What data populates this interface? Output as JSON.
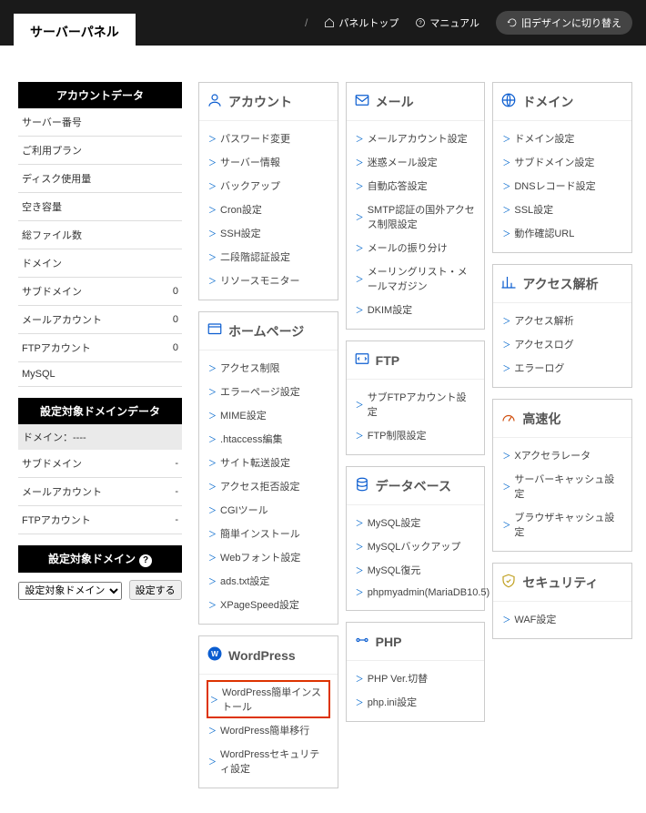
{
  "header": {
    "logo": "サーバーパネル",
    "panel_top": "パネルトップ",
    "manual": "マニュアル",
    "old_design": "旧デザインに切り替え"
  },
  "sidebar": {
    "account": {
      "title": "アカウントデータ",
      "rows": [
        {
          "label": "サーバー番号",
          "value": ""
        },
        {
          "label": "ご利用プラン",
          "value": ""
        },
        {
          "label": "ディスク使用量",
          "value": ""
        },
        {
          "label": "空き容量",
          "value": ""
        },
        {
          "label": "総ファイル数",
          "value": ""
        },
        {
          "label": "ドメイン",
          "value": ""
        },
        {
          "label": "サブドメイン",
          "value": "0"
        },
        {
          "label": "メールアカウント",
          "value": "0"
        },
        {
          "label": "FTPアカウント",
          "value": "0"
        },
        {
          "label": "MySQL",
          "value": ""
        }
      ]
    },
    "domain_data": {
      "title": "設定対象ドメインデータ",
      "domain_label": "ドメイン：",
      "domain_value": "----",
      "rows": [
        {
          "label": "サブドメイン",
          "value": "-"
        },
        {
          "label": "メールアカウント",
          "value": "-"
        },
        {
          "label": "FTPアカウント",
          "value": "-"
        }
      ]
    },
    "set_domain": {
      "title": "設定対象ドメイン",
      "select_placeholder": "設定対象ドメイン",
      "button": "設定する"
    }
  },
  "cards": {
    "account": {
      "title": "アカウント",
      "items": [
        "パスワード変更",
        "サーバー情報",
        "バックアップ",
        "Cron設定",
        "SSH設定",
        "二段階認証設定",
        "リソースモニター"
      ]
    },
    "homepage": {
      "title": "ホームページ",
      "items": [
        "アクセス制限",
        "エラーページ設定",
        "MIME設定",
        ".htaccess編集",
        "サイト転送設定",
        "アクセス拒否設定",
        "CGIツール",
        "簡単インストール",
        "Webフォント設定",
        "ads.txt設定",
        "XPageSpeed設定"
      ]
    },
    "wordpress": {
      "title": "WordPress",
      "items": [
        "WordPress簡単インストール",
        "WordPress簡単移行",
        "WordPressセキュリティ設定"
      ],
      "highlight_index": 0
    },
    "mail": {
      "title": "メール",
      "items": [
        "メールアカウント設定",
        "迷惑メール設定",
        "自動応答設定",
        "SMTP認証の国外アクセス制限設定",
        "メールの振り分け",
        "メーリングリスト・メールマガジン",
        "DKIM設定"
      ]
    },
    "ftp": {
      "title": "FTP",
      "items": [
        "サブFTPアカウント設定",
        "FTP制限設定"
      ]
    },
    "database": {
      "title": "データベース",
      "items": [
        "MySQL設定",
        "MySQLバックアップ",
        "MySQL復元",
        "phpmyadmin(MariaDB10.5)"
      ]
    },
    "php": {
      "title": "PHP",
      "items": [
        "PHP Ver.切替",
        "php.ini設定"
      ]
    },
    "domain": {
      "title": "ドメイン",
      "items": [
        "ドメイン設定",
        "サブドメイン設定",
        "DNSレコード設定",
        "SSL設定",
        "動作確認URL"
      ]
    },
    "access": {
      "title": "アクセス解析",
      "items": [
        "アクセス解析",
        "アクセスログ",
        "エラーログ"
      ]
    },
    "speed": {
      "title": "高速化",
      "items": [
        "Xアクセラレータ",
        "サーバーキャッシュ設定",
        "ブラウザキャッシュ設定"
      ]
    },
    "security": {
      "title": "セキュリティ",
      "items": [
        "WAF設定"
      ]
    }
  }
}
